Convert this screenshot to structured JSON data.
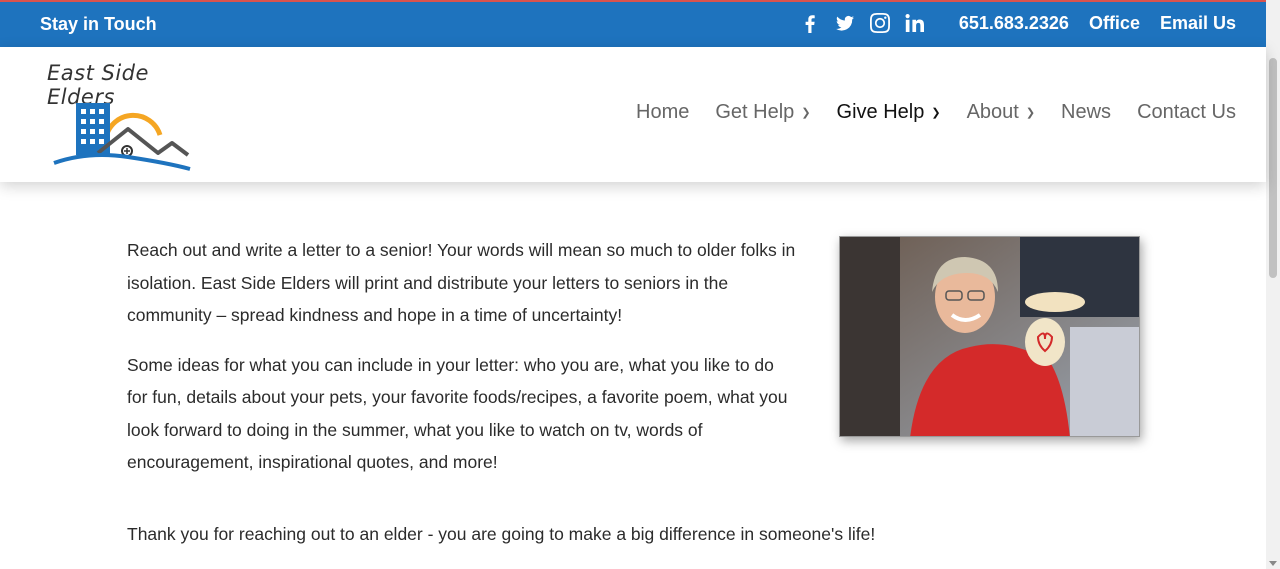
{
  "topbar": {
    "stay_in_touch": "Stay in Touch",
    "social_icons": [
      "facebook-icon",
      "twitter-icon",
      "instagram-icon",
      "linkedin-icon"
    ],
    "phone": "651.683.2326",
    "office": "Office",
    "email": "Email Us",
    "bg_color": "#1e73be"
  },
  "logo": {
    "text": "East Side Elders"
  },
  "nav": {
    "items": [
      {
        "label": "Home"
      },
      {
        "label": "Get Help"
      },
      {
        "label": "Give Help"
      },
      {
        "label": "About"
      },
      {
        "label": "News"
      },
      {
        "label": "Contact Us"
      }
    ],
    "active": "Give Help"
  },
  "content": {
    "paragraph1": "Reach out and write a letter to a senior!  Your words will mean so much to older folks in isolation.  East Side Elders will print and distribute your letters to seniors in the community – spread kindness and hope in a time of uncertainty!",
    "paragraph2": "Some ideas for what you can include in your letter:  who you are, what you like to do for fun, details about your pets, your favorite foods/recipes, a favorite poem, what you look forward to doing in the summer, what you like to watch on tv, words of encouragement, inspirational quotes, and more!",
    "thanks": "Thank you for reaching out to an elder - you are going to make a big difference in someone's life!"
  }
}
